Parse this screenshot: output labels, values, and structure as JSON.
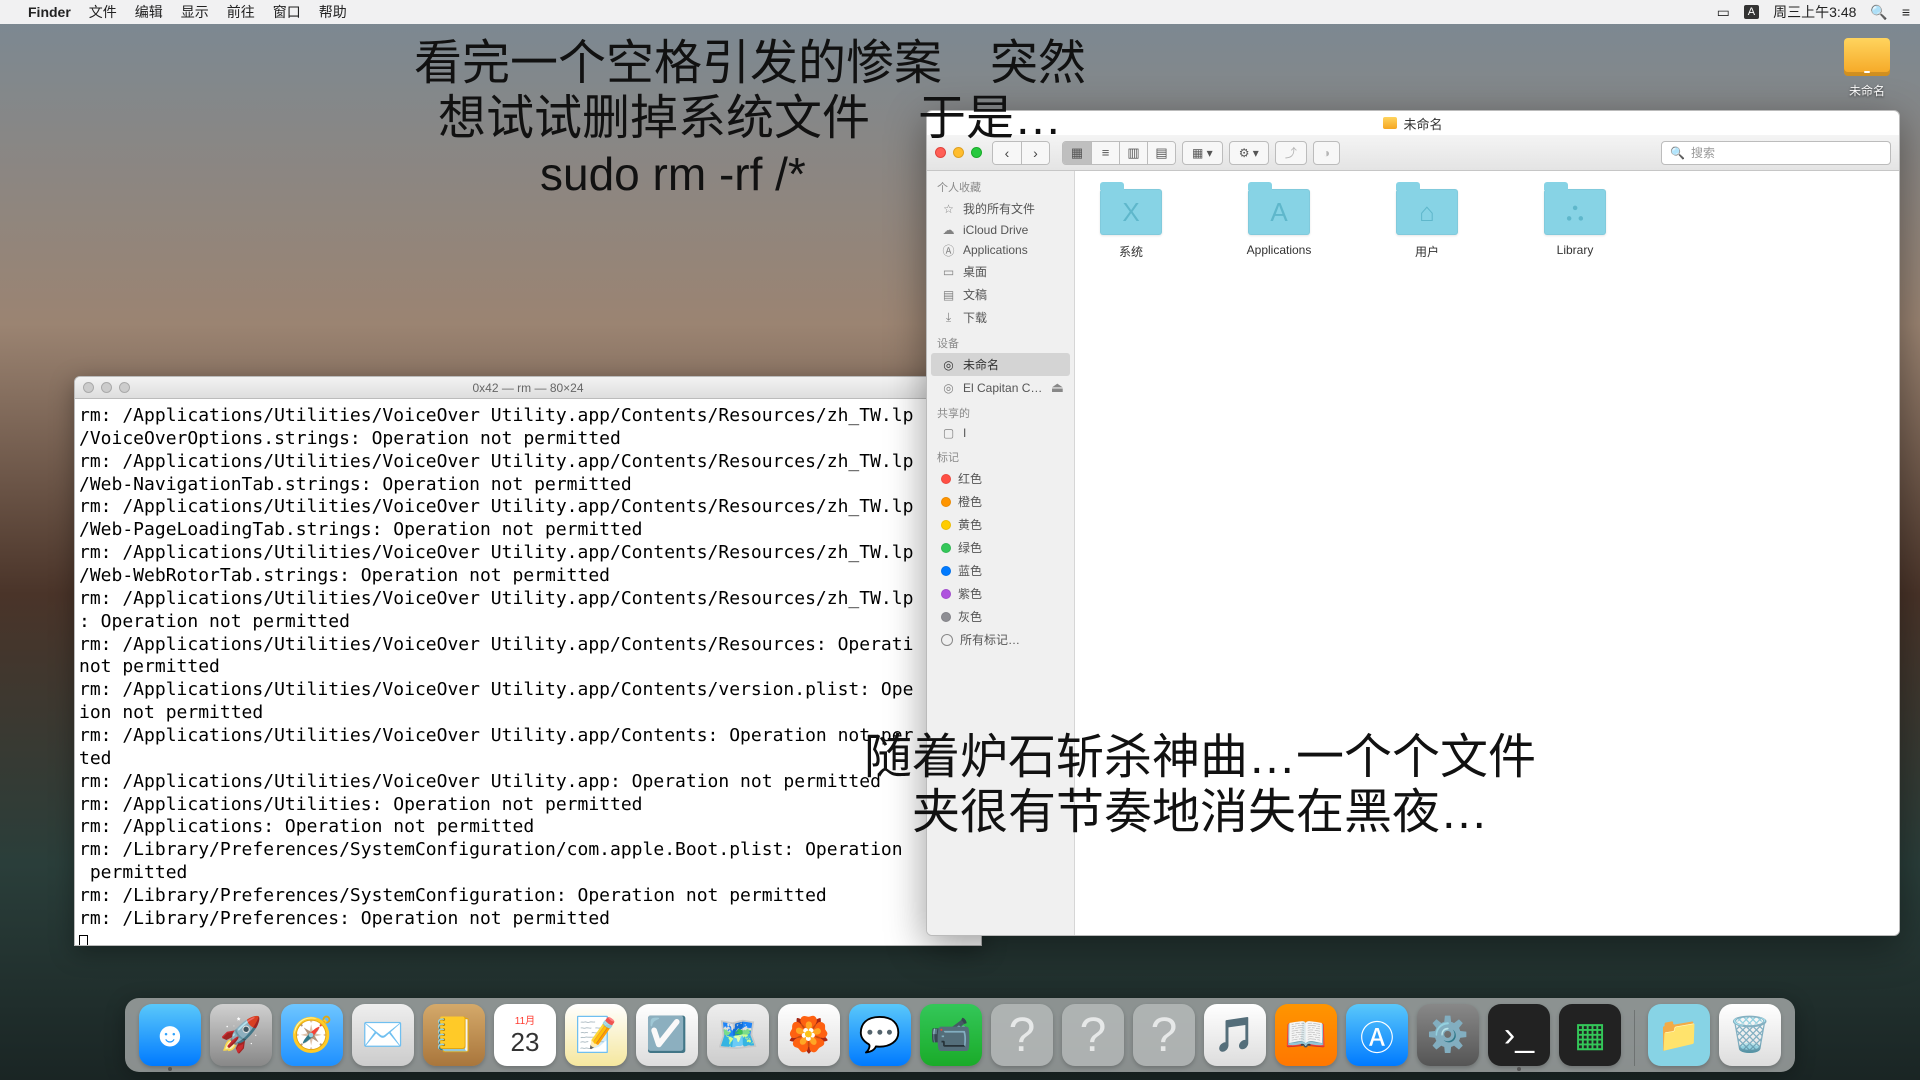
{
  "menubar": {
    "app": "Finder",
    "items": [
      "文件",
      "编辑",
      "显示",
      "前往",
      "窗口",
      "帮助"
    ],
    "input_badge": "A",
    "clock": "周三上午3:48"
  },
  "desktop": {
    "drive_label": "未命名"
  },
  "captions": {
    "line1": "看完一个空格引发的惨案　突然",
    "line2": "想试试删掉系统文件　于是…",
    "cmd": "sudo rm -rf /*",
    "mid1": "随着炉石斩杀神曲…一个个文件",
    "mid2": "夹很有节奏地消失在黑夜…"
  },
  "terminal": {
    "title": "0x42 — rm — 80×24",
    "lines": [
      "rm: /Applications/Utilities/VoiceOver Utility.app/Contents/Resources/zh_TW.lp",
      "/VoiceOverOptions.strings: Operation not permitted",
      "rm: /Applications/Utilities/VoiceOver Utility.app/Contents/Resources/zh_TW.lp",
      "/Web-NavigationTab.strings: Operation not permitted",
      "rm: /Applications/Utilities/VoiceOver Utility.app/Contents/Resources/zh_TW.lp",
      "/Web-PageLoadingTab.strings: Operation not permitted",
      "rm: /Applications/Utilities/VoiceOver Utility.app/Contents/Resources/zh_TW.lp",
      "/Web-WebRotorTab.strings: Operation not permitted",
      "rm: /Applications/Utilities/VoiceOver Utility.app/Contents/Resources/zh_TW.lp",
      ": Operation not permitted",
      "rm: /Applications/Utilities/VoiceOver Utility.app/Contents/Resources: Operati",
      "not permitted",
      "rm: /Applications/Utilities/VoiceOver Utility.app/Contents/version.plist: Ope",
      "ion not permitted",
      "rm: /Applications/Utilities/VoiceOver Utility.app/Contents: Operation not per",
      "ted",
      "rm: /Applications/Utilities/VoiceOver Utility.app: Operation not permitted",
      "rm: /Applications/Utilities: Operation not permitted",
      "rm: /Applications: Operation not permitted",
      "rm: /Library/Preferences/SystemConfiguration/com.apple.Boot.plist: Operation",
      " permitted",
      "rm: /Library/Preferences/SystemConfiguration: Operation not permitted",
      "rm: /Library/Preferences: Operation not permitted"
    ]
  },
  "finder": {
    "title": "未命名",
    "search_placeholder": "搜索",
    "sidebar": {
      "favorites_head": "个人收藏",
      "favorites": [
        {
          "label": "我的所有文件",
          "icon": "star"
        },
        {
          "label": "iCloud Drive",
          "icon": "cloud"
        },
        {
          "label": "Applications",
          "icon": "A"
        },
        {
          "label": "桌面",
          "icon": "desk"
        },
        {
          "label": "文稿",
          "icon": "doc"
        },
        {
          "label": "下载",
          "icon": "down"
        }
      ],
      "devices_head": "设备",
      "devices": [
        {
          "label": "未命名",
          "eject": false,
          "selected": true
        },
        {
          "label": "El Capitan C…",
          "eject": true
        }
      ],
      "shared_head": "共享的",
      "shared": [
        {
          "label": "I"
        }
      ],
      "tags_head": "标记",
      "tags": [
        {
          "label": "红色",
          "color": "red"
        },
        {
          "label": "橙色",
          "color": "orange"
        },
        {
          "label": "黄色",
          "color": "yellow"
        },
        {
          "label": "绿色",
          "color": "green"
        },
        {
          "label": "蓝色",
          "color": "blue"
        },
        {
          "label": "紫色",
          "color": "purple"
        },
        {
          "label": "灰色",
          "color": "gray"
        }
      ],
      "all_tags": "所有标记…"
    },
    "folders": [
      {
        "label": "系统",
        "glyph": "X"
      },
      {
        "label": "Applications",
        "glyph": "A"
      },
      {
        "label": "用户",
        "glyph": "⌂"
      },
      {
        "label": "Library",
        "glyph": "⛬"
      }
    ]
  },
  "dock": {
    "calendar_day": "23",
    "calendar_month": "11月"
  }
}
